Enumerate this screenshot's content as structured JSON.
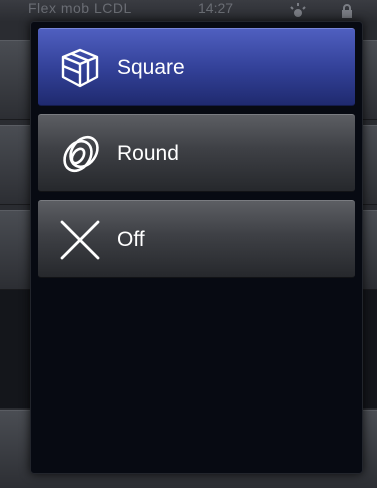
{
  "status_bar": {
    "carrier_text": "Flex mob LCDL",
    "time": "14:27",
    "sun_icon": "brightness-icon",
    "lock_icon": "lock-icon"
  },
  "menu": {
    "items": [
      {
        "label": "Square",
        "icon": "cube-outline-icon",
        "selected": true
      },
      {
        "label": "Round",
        "icon": "ring-icon",
        "selected": false
      },
      {
        "label": "Off",
        "icon": "x-icon",
        "selected": false
      }
    ]
  },
  "colors": {
    "selected_item": "#34429a",
    "normal_item": "#3e4045",
    "popup_background": "#070a12",
    "text": "#ffffff"
  }
}
